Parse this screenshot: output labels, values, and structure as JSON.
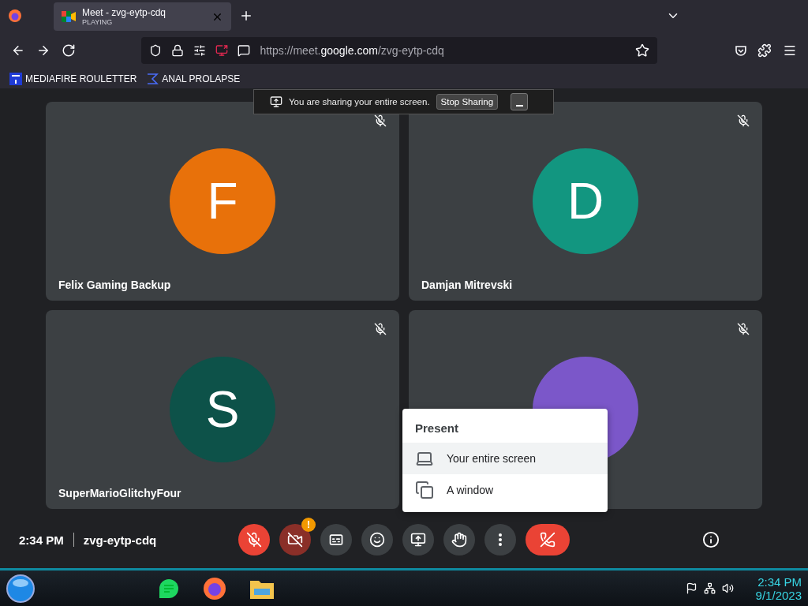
{
  "browser": {
    "tabs": [
      {
        "title": "Meet - zvg-eytp-cdq",
        "subtitle": "PLAYING",
        "selected": true
      }
    ],
    "url": {
      "host_start": "https://meet.",
      "host_main": "google.com",
      "path": "/zvg-eytp-cdq"
    },
    "bookmarks": [
      {
        "label": "MEDIAFIRE ROULETTER",
        "kind": "mediafire"
      },
      {
        "label": "ANAL PROLAPSE",
        "kind": "sigma"
      }
    ]
  },
  "share_banner": {
    "message": "You are sharing your entire screen.",
    "button": "Stop Sharing"
  },
  "participants": [
    {
      "name": "Felix Gaming Backup",
      "initial": "F",
      "color": "#e8710a",
      "muted": true
    },
    {
      "name": "Damjan Mitrevski",
      "initial": "D",
      "color": "#129680",
      "muted": true
    },
    {
      "name": "SuperMarioGlitchyFour",
      "initial": "S",
      "color": "#0d5249",
      "muted": true
    },
    {
      "color": "#7b57c9",
      "muted": true
    }
  ],
  "controls": {
    "time": "2:34 PM",
    "meeting_code": "zvg-eytp-cdq",
    "buttons": [
      {
        "kind": "mic",
        "on": false
      },
      {
        "kind": "camera",
        "on": false,
        "alert": "!"
      },
      {
        "kind": "captions",
        "on": false
      },
      {
        "kind": "emoji",
        "on": false
      },
      {
        "kind": "present",
        "on": false
      },
      {
        "kind": "hand",
        "on": false
      },
      {
        "kind": "more",
        "on": false
      },
      {
        "kind": "leave"
      }
    ]
  },
  "present_menu": {
    "title": "Present",
    "items": [
      {
        "label": "Your entire screen",
        "kind": "screen",
        "selected": true
      },
      {
        "label": "A window",
        "kind": "window",
        "selected": false
      }
    ]
  },
  "taskbar": {
    "time": "2:34 PM",
    "date": "9/1/2023"
  }
}
